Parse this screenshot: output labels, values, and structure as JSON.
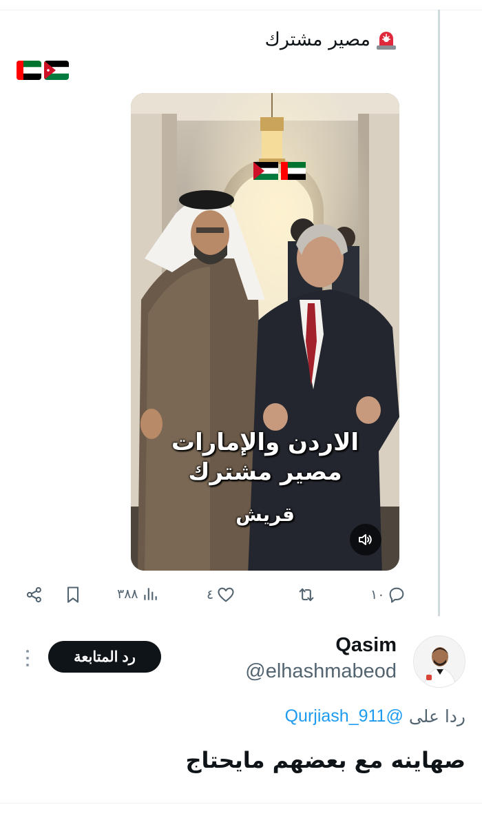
{
  "tweet": {
    "text": "مصير مشترك",
    "leading_icon": "police-siren-icon",
    "flags": [
      "uae-flag-icon",
      "jordan-flag-icon"
    ]
  },
  "media": {
    "caption_line1": "الاردن والإمارات",
    "caption_line2": "مصير مشترك",
    "caption_source": "قريش",
    "overlay_flags": [
      "jordan-flag-icon",
      "uae-flag-icon"
    ],
    "mute_icon": "speaker-icon"
  },
  "actions": {
    "replies": "١٠",
    "retweets": "",
    "likes": "٤",
    "views": "٣٨٨",
    "icons": [
      "reply-icon",
      "retweet-icon",
      "like-icon",
      "views-icon",
      "bookmark-icon",
      "share-icon"
    ]
  },
  "reply": {
    "display_name": "Qasim",
    "handle": "@elhashmabeod",
    "follow_label": "رد المتابعة",
    "replying_prefix": "ردا على",
    "replying_mention": "@Qurjiash_911",
    "text": "صهاينه مع بعضهم مايحتاج"
  },
  "colors": {
    "accent": "#1d9bf0",
    "muted": "#536471",
    "text": "#0f1419",
    "button_bg": "#0f1419"
  }
}
